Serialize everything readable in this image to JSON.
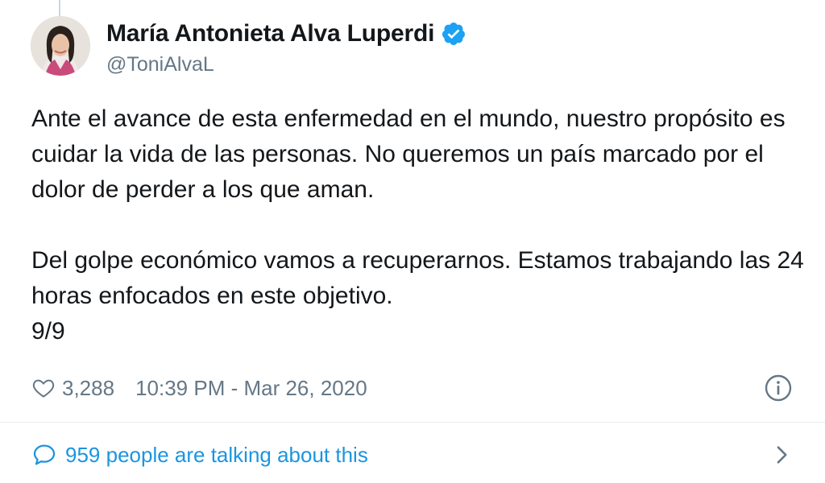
{
  "author": {
    "display_name": "María Antonieta Alva Luperdi",
    "handle": "@ToniAlvaL",
    "verified": true
  },
  "tweet": {
    "paragraphs": [
      "Ante el avance de esta enfermedad en el mundo, nuestro propósito es cuidar la vida de las personas. No queremos un país marcado por el dolor de perder a los que aman.",
      "Del golpe económico vamos a recuperarnos. Estamos trabajando las 24 horas enfocados en este objetivo.",
      "9/9"
    ],
    "likes": "3,288",
    "timestamp": "10:39 PM - Mar 26, 2020"
  },
  "footer": {
    "talking_text": "959 people are talking about this"
  },
  "icons": {
    "verified": "verified-badge-icon",
    "like": "heart-icon",
    "info": "info-icon",
    "comment": "comment-icon",
    "chevron": "chevron-right-icon"
  },
  "colors": {
    "accent": "#1b95e0",
    "verified": "#1da1f2",
    "secondary_text": "#657786",
    "primary_text": "#14171a",
    "divider": "#e6ecf0"
  }
}
